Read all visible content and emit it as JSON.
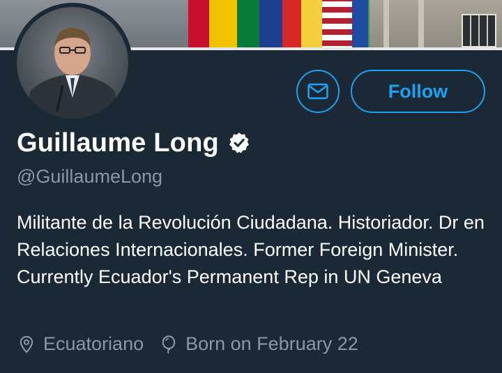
{
  "profile": {
    "name": "Guillaume Long",
    "handle": "@GuillaumeLong",
    "bio": "Militante de la Revolución Ciudadana. Historiador. Dr en Relaciones Internacionales. Former Foreign Minister. Currently Ecuador's Permanent Rep in UN Geneva",
    "location": "Ecuatoriano",
    "birthday": "Born on February 22",
    "verified": true
  },
  "actions": {
    "follow_label": "Follow",
    "message_icon": "mail-icon"
  },
  "colors": {
    "background": "#1b2836",
    "accent": "#1da1f2",
    "secondary_text": "#8899a6"
  },
  "icons": {
    "verified": "verified-badge-icon",
    "location": "location-pin-icon",
    "birthday": "balloon-icon"
  }
}
